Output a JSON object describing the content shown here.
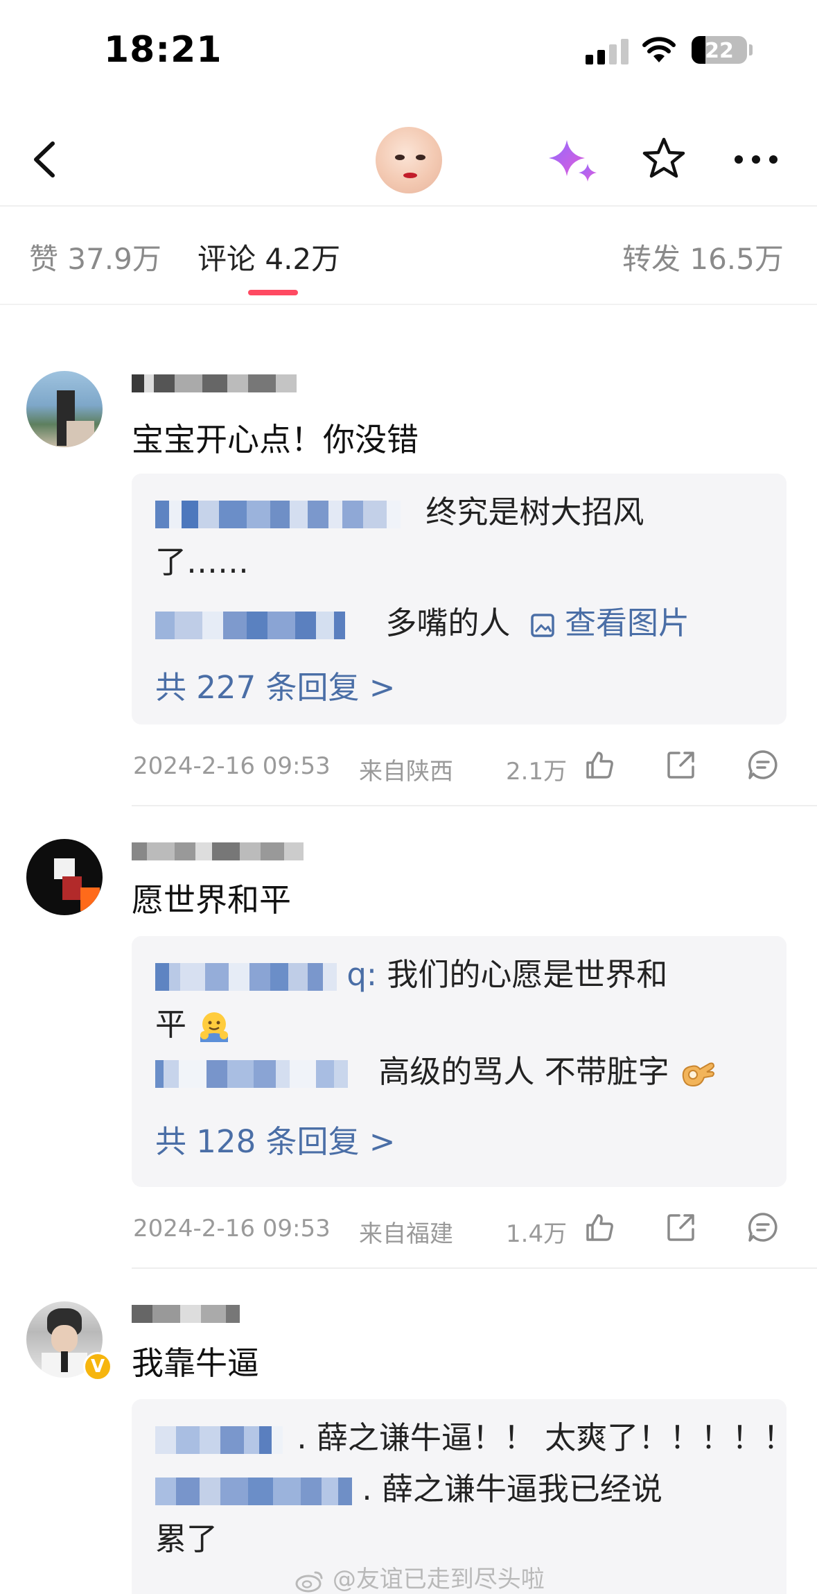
{
  "status_bar": {
    "time": "18:21",
    "battery": "22"
  },
  "tabs": {
    "likes": "赞 37.9万",
    "comments": "评论 4.2万",
    "reposts": "转发 16.5万"
  },
  "comments": [
    {
      "text": "宝宝开心点！你没错",
      "replies": [
        {
          "text": "终究是树大招风"
        },
        {
          "text": "了……"
        },
        {
          "text": "多嘴的人",
          "link": "查看图片"
        }
      ],
      "more_replies": "共 227 条回复 >",
      "date": "2024-2-16 09:53",
      "location": "来自陕西",
      "likes": "2.1万"
    },
    {
      "text": "愿世界和平",
      "replies": [
        {
          "suffix": "q:",
          "text": " 我们的心愿是世界和"
        },
        {
          "text": "平"
        },
        {
          "text": "高级的骂人 不带脏字"
        }
      ],
      "more_replies": "共 128 条回复 >",
      "date": "2024-2-16 09:53",
      "location": "来自福建",
      "likes": "1.4万"
    },
    {
      "text": "我靠牛逼",
      "replies": [
        {
          "text": ". 薛之谦牛逼！！ 太爽了！！！！！"
        },
        {
          "text": ". 薛之谦牛逼我已经说"
        },
        {
          "text": "累了"
        }
      ]
    }
  ],
  "watermark": "@友谊已走到尽头啦",
  "colors": {
    "accent": "#ff4a62",
    "link": "#4a6ea6"
  }
}
